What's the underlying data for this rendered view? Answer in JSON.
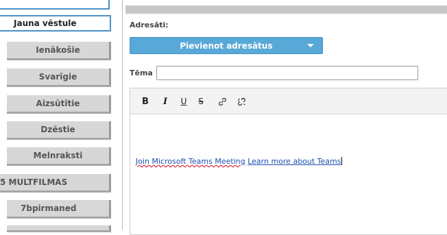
{
  "sidebar": {
    "compose_label": "Jauna vēstule",
    "items": [
      {
        "label": "Ienākošie"
      },
      {
        "label": "Svarīgie"
      },
      {
        "label": "Aizsūtītie"
      },
      {
        "label": "Dzēstie"
      },
      {
        "label": "Melnraksti"
      },
      {
        "label": "5 MULTFILMAS"
      },
      {
        "label": "7bpirmaned"
      }
    ]
  },
  "compose": {
    "recipients_label": "Adresāti:",
    "add_recipients_label": "Pievienot adresātus",
    "subject_label": "Tēma",
    "subject_value": ""
  },
  "toolbar": {
    "bold": "B",
    "italic": "I",
    "underline": "U",
    "strike": "S",
    "icons": [
      "bold-icon",
      "italic-icon",
      "underline-icon",
      "strikethrough-icon",
      "link-icon",
      "unlink-icon"
    ]
  },
  "editor": {
    "link1": "Join Microsoft Teams Meeting",
    "link2": "Learn more about Teams"
  },
  "colors": {
    "accent": "#58a8d8",
    "active_border": "#4a90c8",
    "sidebar_bg": "#d7d7d7"
  }
}
